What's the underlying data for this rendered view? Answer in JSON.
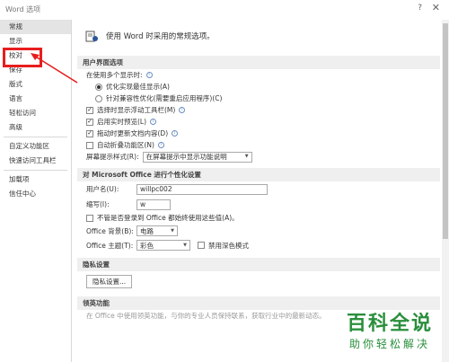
{
  "window": {
    "title": "Word 选项",
    "help": "?",
    "close": "✕"
  },
  "sidebar": {
    "items": [
      {
        "label": "常规",
        "name": "sidebar-item-general",
        "selected": true
      },
      {
        "label": "显示",
        "name": "sidebar-item-display"
      },
      {
        "label": "校对",
        "name": "sidebar-item-proofing"
      },
      {
        "label": "保存",
        "name": "sidebar-item-save"
      },
      {
        "label": "版式",
        "name": "sidebar-item-typography"
      },
      {
        "label": "语言",
        "name": "sidebar-item-language"
      },
      {
        "label": "轻松访问",
        "name": "sidebar-item-accessibility"
      },
      {
        "label": "高级",
        "name": "sidebar-item-advanced"
      },
      {
        "sep": true
      },
      {
        "label": "自定义功能区",
        "name": "sidebar-item-customize-ribbon"
      },
      {
        "label": "快速访问工具栏",
        "name": "sidebar-item-quick-access"
      },
      {
        "sep": true
      },
      {
        "label": "加载项",
        "name": "sidebar-item-addins"
      },
      {
        "label": "信任中心",
        "name": "sidebar-item-trust-center"
      }
    ]
  },
  "main": {
    "header": "使用 Word 时采用的常规选项。",
    "ui_section": {
      "title": "用户界面选项",
      "multi_display_label": "在使用多个显示时:",
      "opt_appearance": "优化实现最佳显示(A)",
      "opt_compat": "针对兼容性优化(需要重启应用程序)(C)",
      "chk_minitoolbar": "选择时显示浮动工具栏(M)",
      "chk_live_preview": "启用实时预览(L)",
      "chk_update_drag": "拖动时更新文档内容(D)",
      "chk_collapse_ribbon": "自动折叠功能区(N)",
      "screentip_label": "屏幕提示样式(R):",
      "screentip_value": "在屏幕提示中显示功能说明"
    },
    "personalize_section": {
      "title": "对 Microsoft Office 进行个性化设置",
      "username_label": "用户名(U):",
      "username_value": "willpc002",
      "initials_label": "缩写(I):",
      "initials_value": "w",
      "chk_always_use": "不管是否登录到 Office 都始终使用这些值(A)。",
      "background_label": "Office 背景(B):",
      "background_value": "电路",
      "theme_label": "Office 主题(T):",
      "theme_value": "彩色",
      "chk_dark_mode": "禁用深色模式"
    },
    "privacy_section": {
      "title": "隐私设置",
      "button": "隐私设置..."
    },
    "startup_section": {
      "title": "领英功能",
      "cut_text": "在 Office 中使用领英功能，与你的专业人员保持联系，获取行业中的最新动态。"
    }
  },
  "watermark": {
    "big": "百科全说",
    "small": "助你轻松解决"
  },
  "colors": {
    "highlight": "#e81d1d",
    "watermark": "#2a8f3c",
    "section_bg": "#efefef"
  }
}
